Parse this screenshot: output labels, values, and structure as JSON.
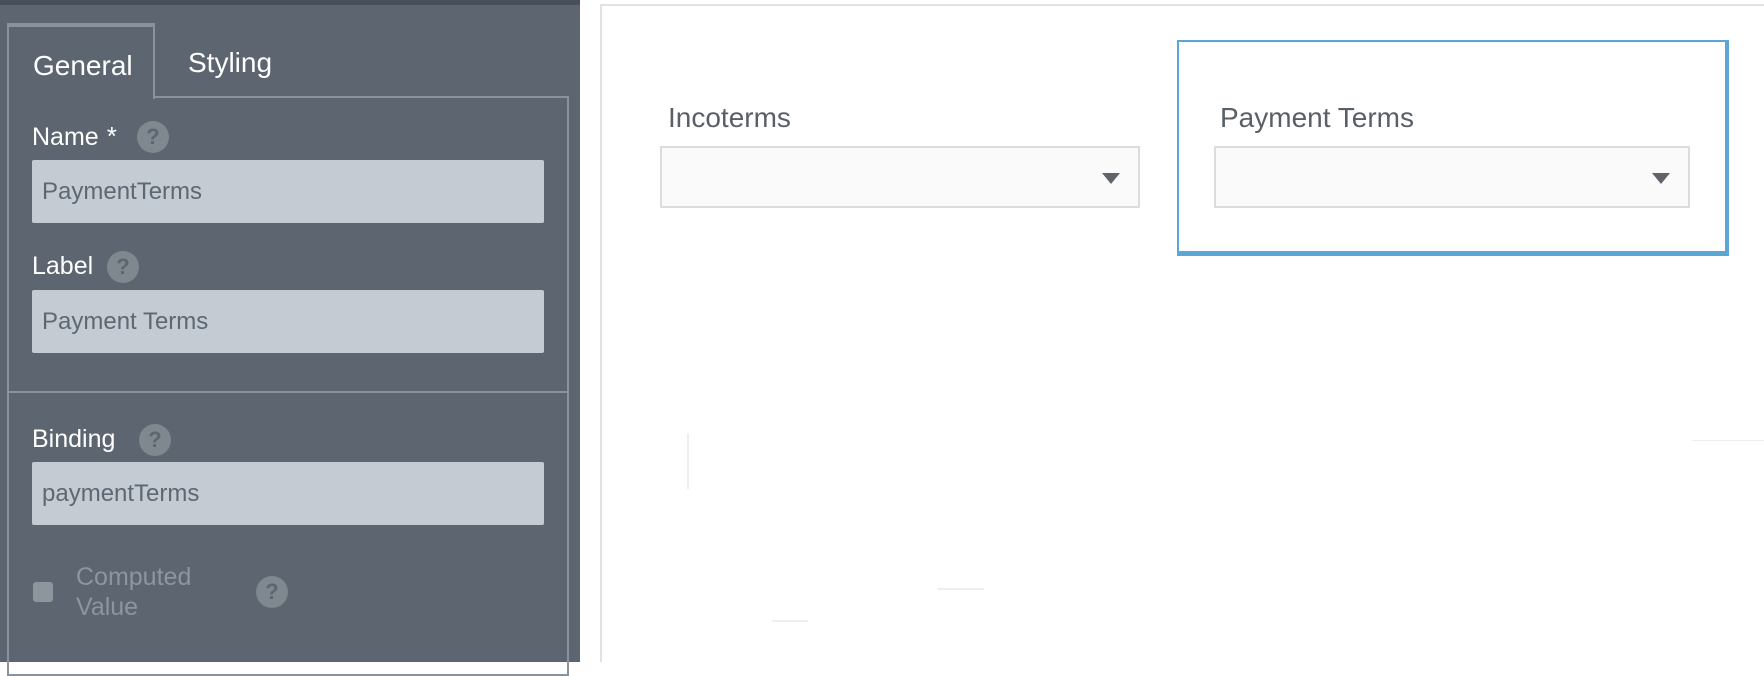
{
  "properties_panel": {
    "tabs": [
      {
        "label": "General",
        "active": true
      },
      {
        "label": "Styling",
        "active": false
      }
    ],
    "name_field": {
      "label": "Name",
      "required_marker": "*",
      "value": "PaymentTerms"
    },
    "label_field": {
      "label": "Label",
      "value": "Payment Terms"
    },
    "binding_field": {
      "label": "Binding",
      "value": "paymentTerms"
    },
    "computed_value": {
      "label": "Computed Value",
      "checked": false
    },
    "help_glyph": "?"
  },
  "form_canvas": {
    "fields": [
      {
        "label": "Incoterms",
        "value": "",
        "selected": false
      },
      {
        "label": "Payment Terms",
        "value": "",
        "selected": true
      }
    ]
  },
  "colors": {
    "panel_background": "#5c6570",
    "input_background": "#c4cbd3",
    "selection_accent": "#5aa7d6"
  },
  "icons": {
    "help": "question-circle-icon",
    "dropdown": "caret-down-icon"
  }
}
